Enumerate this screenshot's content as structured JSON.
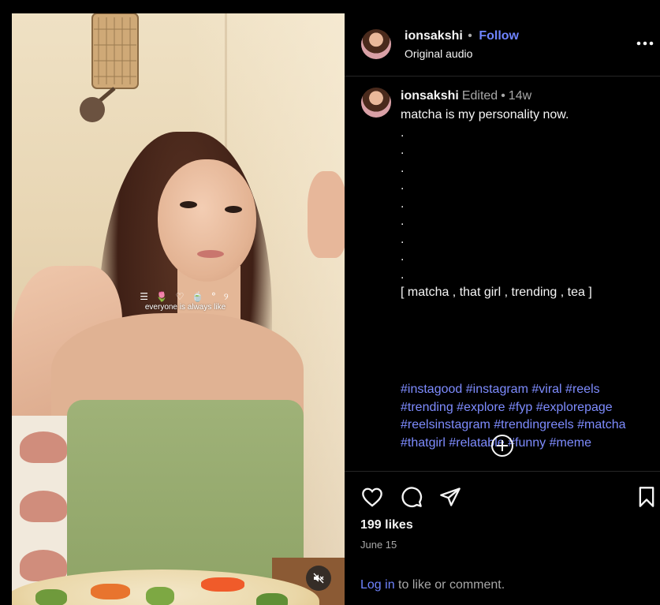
{
  "header": {
    "username": "ionsakshi",
    "separator": "•",
    "follow_label": "Follow",
    "subtitle": "Original audio",
    "more_icon": "more-horizontal-icon"
  },
  "media": {
    "sticker_icons": "☰ 🌷 ♡ 🍵 ° ୨",
    "sticker_text": "everyone is always like",
    "mute_icon": "speaker-muted-icon"
  },
  "caption": {
    "username": "ionsakshi",
    "edited": "Edited",
    "separator": "•",
    "time": "14w",
    "text": "matcha is my personality now.\n.\n.\n.\n.\n.\n.\n.\n.\n.\n[ matcha , that girl , trending , tea ]",
    "hashtags": [
      "#instagood",
      "#instagram",
      "#viral",
      "#reels",
      "#trending",
      "#explore",
      "#fyp",
      "#explorepage",
      "#reelsinstagram",
      "#trendingreels",
      "#matcha",
      "#thatgirl",
      "#relatable",
      "#funny",
      "#meme"
    ],
    "add_icon": "plus-circle-icon"
  },
  "actions": {
    "like_icon": "heart-icon",
    "comment_icon": "comment-icon",
    "share_icon": "send-icon",
    "save_icon": "bookmark-icon"
  },
  "likes": "199 likes",
  "date": "June 15",
  "login": {
    "link": "Log in",
    "text": " to like or comment."
  },
  "colors": {
    "background": "#000000",
    "link": "#6f84ff",
    "hashtag": "#7e8cff",
    "muted_text": "#a8a8a8",
    "text": "#f5f5f5"
  }
}
